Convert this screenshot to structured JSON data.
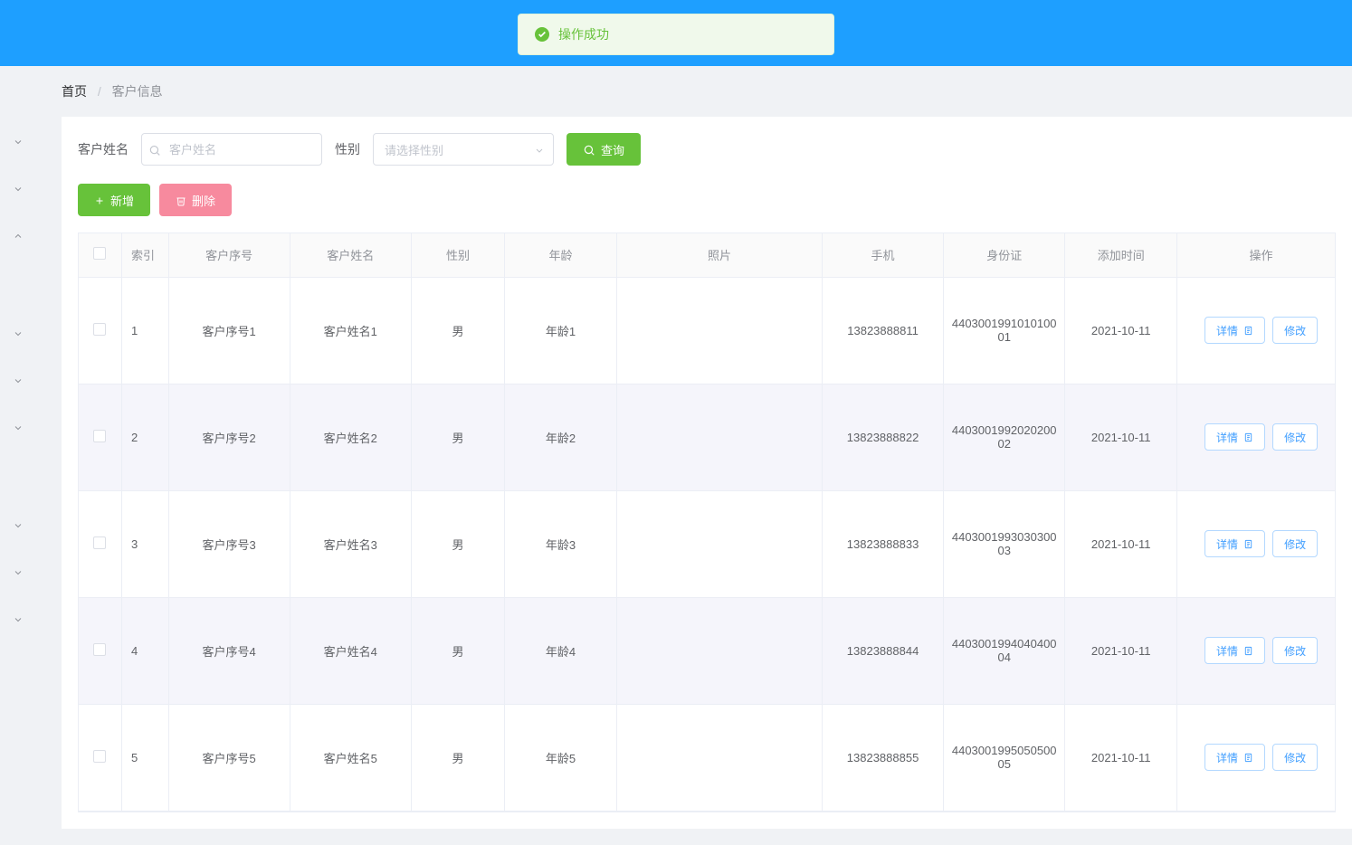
{
  "toast": {
    "message": "操作成功"
  },
  "breadcrumb": {
    "home": "首页",
    "current": "客户信息"
  },
  "search": {
    "name_label": "客户姓名",
    "name_placeholder": "客户姓名",
    "gender_label": "性别",
    "gender_placeholder": "请选择性别",
    "query_btn": "查询"
  },
  "actions": {
    "add": "新增",
    "delete": "删除"
  },
  "table": {
    "headers": {
      "index": "索引",
      "code": "客户序号",
      "name": "客户姓名",
      "gender": "性别",
      "age": "年龄",
      "photo": "照片",
      "phone": "手机",
      "idcard": "身份证",
      "time": "添加时间",
      "actions": "操作"
    },
    "row_actions": {
      "detail": "详情",
      "edit": "修改"
    },
    "rows": [
      {
        "index": "1",
        "code": "客户序号1",
        "name": "客户姓名1",
        "gender": "男",
        "age": "年龄1",
        "phone": "13823888811",
        "idcard": "440300199101010001",
        "time": "2021-10-11"
      },
      {
        "index": "2",
        "code": "客户序号2",
        "name": "客户姓名2",
        "gender": "男",
        "age": "年龄2",
        "phone": "13823888822",
        "idcard": "440300199202020002",
        "time": "2021-10-11"
      },
      {
        "index": "3",
        "code": "客户序号3",
        "name": "客户姓名3",
        "gender": "男",
        "age": "年龄3",
        "phone": "13823888833",
        "idcard": "440300199303030003",
        "time": "2021-10-11"
      },
      {
        "index": "4",
        "code": "客户序号4",
        "name": "客户姓名4",
        "gender": "男",
        "age": "年龄4",
        "phone": "13823888844",
        "idcard": "440300199404040004",
        "time": "2021-10-11"
      },
      {
        "index": "5",
        "code": "客户序号5",
        "name": "客户姓名5",
        "gender": "男",
        "age": "年龄5",
        "phone": "13823888855",
        "idcard": "440300199505050005",
        "time": "2021-10-11"
      }
    ]
  }
}
